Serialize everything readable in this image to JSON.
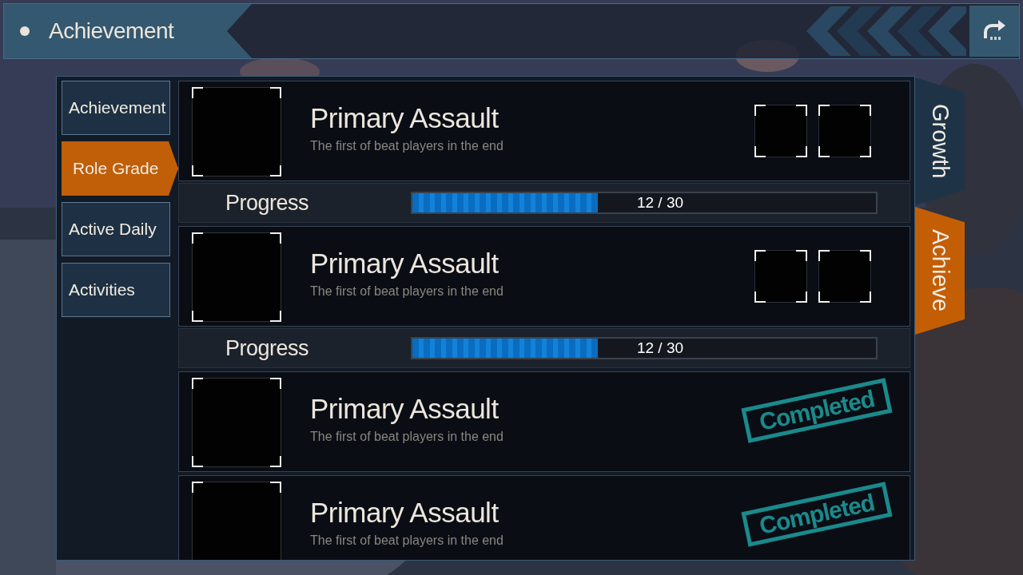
{
  "header": {
    "title": "Achievement"
  },
  "sidebar": {
    "items": [
      {
        "label": "Achievement",
        "selected": false
      },
      {
        "label": "Role Grade",
        "selected": true
      },
      {
        "label": "Active Daily",
        "selected": false
      },
      {
        "label": "Activities",
        "selected": false
      }
    ]
  },
  "achievements": [
    {
      "title": "Primary Assault",
      "description": "The first of beat players in the end",
      "completed": false,
      "progress": {
        "label": "Progress",
        "level": 0.4,
        "reading": "12 / 30"
      }
    },
    {
      "title": "Primary Assault",
      "description": "The first of beat players in the end",
      "completed": false,
      "progress": {
        "label": "Progress",
        "level": 0.4,
        "reading": "12 / 30"
      }
    },
    {
      "title": "Primary Assault",
      "description": "The first of beat players in the end",
      "completed": true,
      "stamp": "Completed"
    },
    {
      "title": "Primary Assault",
      "description": "The first of beat players in the end",
      "completed": true,
      "stamp": "Completed"
    }
  ],
  "side_tabs": [
    {
      "label": "Growth",
      "selected": false
    },
    {
      "label": "Achieve",
      "selected": true
    }
  ]
}
